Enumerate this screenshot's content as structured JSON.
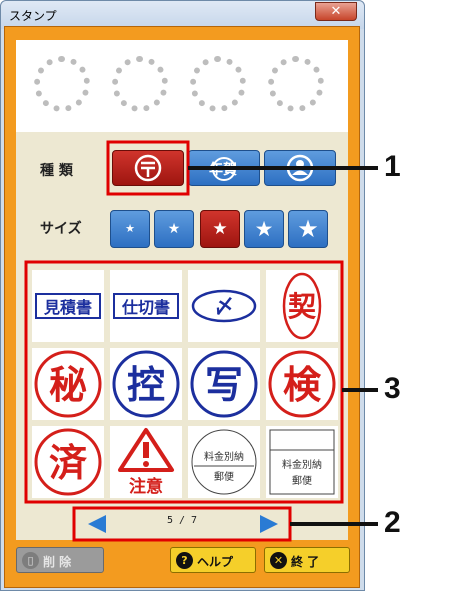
{
  "window": {
    "title": "スタンプ",
    "close_glyph": "✕"
  },
  "stamp_slots": [
    "",
    "",
    "",
    ""
  ],
  "labels": {
    "type": "種 類",
    "size": "サイズ"
  },
  "type_buttons": [
    {
      "name": "postal-mark",
      "selected": true
    },
    {
      "name": "nenga",
      "selected": false,
      "text": "年賀"
    },
    {
      "name": "person",
      "selected": false
    }
  ],
  "size_buttons": [
    {
      "star": "★",
      "selected": false
    },
    {
      "star": "★",
      "selected": false
    },
    {
      "star": "★",
      "selected": true
    },
    {
      "star": "★",
      "selected": false
    },
    {
      "star": "★",
      "selected": false
    }
  ],
  "stamps": [
    {
      "text": "見積書",
      "kind": "rect-blue"
    },
    {
      "text": "仕切書",
      "kind": "rect-blue"
    },
    {
      "text": "〆",
      "kind": "oval-blue"
    },
    {
      "text": "契",
      "kind": "oval-red"
    },
    {
      "text": "秘",
      "kind": "circle-red"
    },
    {
      "text": "控",
      "kind": "circle-blue"
    },
    {
      "text": "写",
      "kind": "circle-blue"
    },
    {
      "text": "検",
      "kind": "circle-red"
    },
    {
      "text": "済",
      "kind": "circle-red"
    },
    {
      "text": "注意",
      "kind": "warning"
    },
    {
      "text": "料金別納",
      "text2": "郵便",
      "kind": "circle-plain"
    },
    {
      "text": "料金別納",
      "text2": "郵便",
      "kind": "rect-plain"
    }
  ],
  "pager": {
    "text": "5 / 7"
  },
  "buttons": {
    "delete": "削 除",
    "help": "ヘルプ",
    "end": "終 了"
  },
  "callouts": {
    "c1": "1",
    "c2": "2",
    "c3": "3"
  },
  "colors": {
    "frame": "#f39b1f",
    "blue": "#2a7bd4",
    "red": "#c8201a",
    "yellow": "#f5cf2a"
  }
}
